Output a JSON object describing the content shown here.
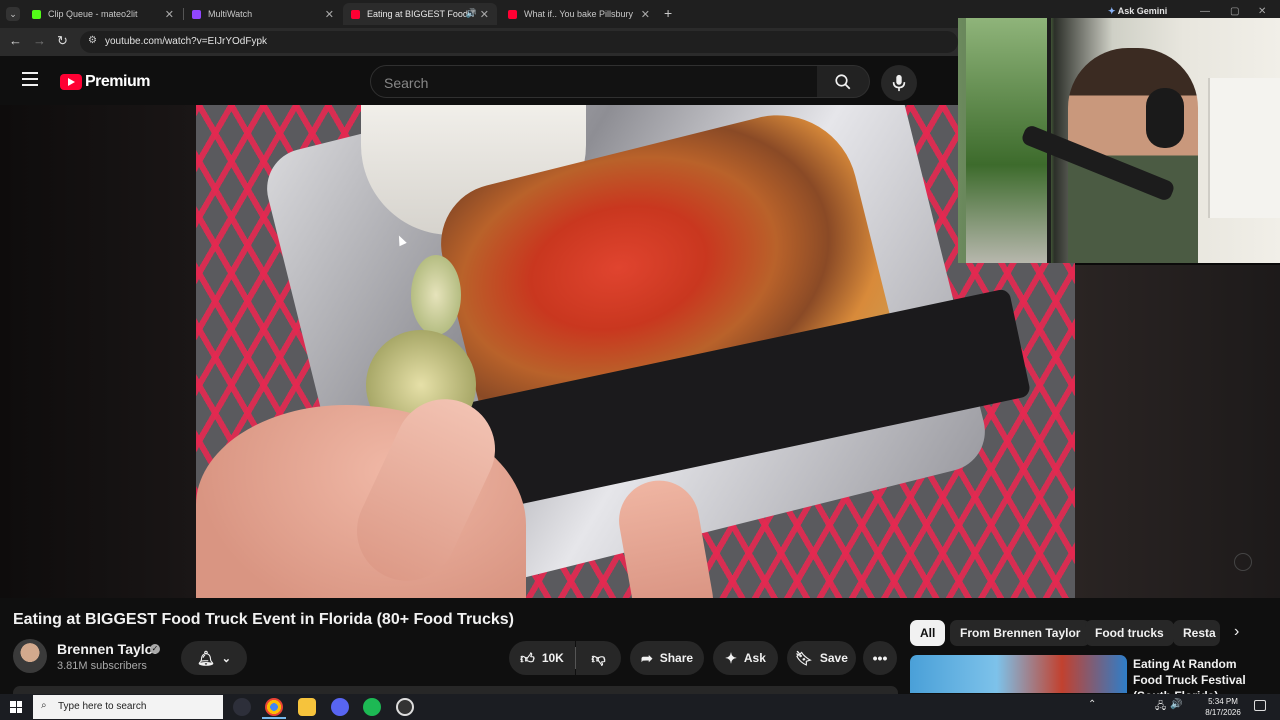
{
  "browser": {
    "tabs": [
      {
        "title": "Clip Queue - mateo2lit",
        "color": "#53fc18"
      },
      {
        "title": "MultiWatch",
        "color": "#9146ff"
      },
      {
        "title": "Eating at BIGGEST Food Tru",
        "color": "#ff0033"
      },
      {
        "title": "What if.. You bake Pillsbury Coo",
        "color": "#ff0033"
      }
    ],
    "url": "youtube.com/watch?v=EIJrYOdFypk",
    "ask_gemini": "Ask Gemini"
  },
  "youtube": {
    "logo_text": "Premium",
    "search_placeholder": "Search",
    "video": {
      "title": "Eating at BIGGEST Food Truck Event in Florida (80+ Food Trucks)",
      "channel": "Brennen Taylor",
      "subscribers": "3.81M subscribers",
      "likes": "10K",
      "share_label": "Share",
      "ask_label": "Ask",
      "save_label": "Save"
    },
    "chips": [
      "All",
      "From Brennen Taylor",
      "Food trucks",
      "Resta"
    ],
    "recommended": {
      "title": "Eating At Random Food Truck Festival (South Florida)"
    }
  },
  "taskbar": {
    "search_placeholder": "Type here to search",
    "time": "5:34 PM",
    "date": "8/17/2026"
  },
  "colors": {
    "accent": "#ff0033",
    "background": "#0f0f0f"
  }
}
